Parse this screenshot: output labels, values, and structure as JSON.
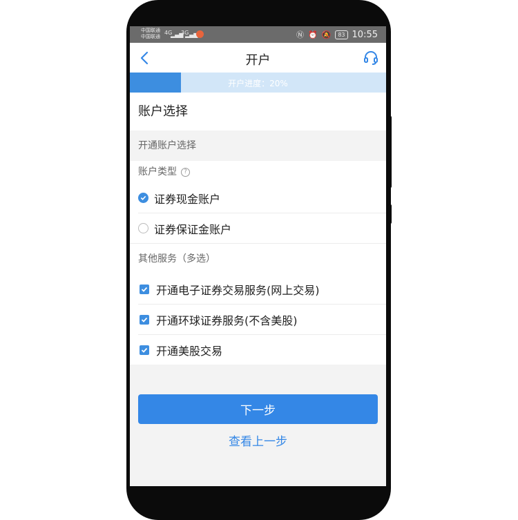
{
  "status_bar": {
    "carrier_1": "中国联通",
    "carrier_2": "中国联通",
    "network_1": "4G",
    "network_2": "3G",
    "battery": "83",
    "time": "10:55",
    "icons": [
      "nfc-icon",
      "alarm-icon",
      "mute-icon",
      "battery-icon"
    ]
  },
  "nav": {
    "title": "开户",
    "back_icon": "chevron-left-icon",
    "service_icon": "headset-icon"
  },
  "progress": {
    "label": "开户进度：20%",
    "fraction": 0.2,
    "fill_color": "#3d8ee0",
    "track_color": "#d2e6f8"
  },
  "page": {
    "section_title": "账户选择",
    "group_header": "开通账户选择"
  },
  "account_type": {
    "label": "账户类型",
    "options": [
      {
        "label": "证券现金账户",
        "checked": true
      },
      {
        "label": "证券保证金账户",
        "checked": false
      }
    ]
  },
  "other_services": {
    "label": "其他服务（多选）",
    "options": [
      {
        "label": "开通电子证券交易服务(网上交易)",
        "checked": true
      },
      {
        "label": "开通环球证券服务(不含美股)",
        "checked": true
      },
      {
        "label": "开通美股交易",
        "checked": true
      }
    ]
  },
  "actions": {
    "next_label": "下一步",
    "prev_label": "查看上一步"
  },
  "colors": {
    "accent": "#3487e6",
    "phone_frame": "#0b0b0b"
  }
}
